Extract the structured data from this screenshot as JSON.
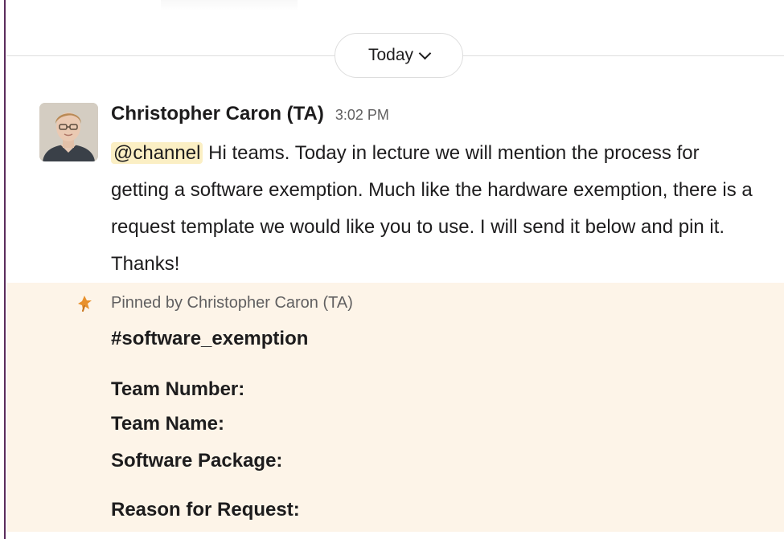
{
  "date_divider": {
    "label": "Today"
  },
  "message": {
    "author": "Christopher Caron (TA)",
    "timestamp": "3:02 PM",
    "mention": "@channel",
    "body": "Hi teams. Today in lecture we will mention the process for getting a software exemption. Much like the hardware exemption, there is a request template we would like you to use. I will send it below and pin it. Thanks!"
  },
  "pinned": {
    "label": "Pinned by Christopher Caron (TA)",
    "lines": [
      "#software_exemption",
      "Team Number:",
      "Team Name:",
      "Software Package:",
      "Reason for Request:"
    ]
  },
  "colors": {
    "sidebar_edge": "#5b2c5c",
    "pinned_background": "#fdf4e8",
    "mention_highlight": "#fbefc4",
    "pin_icon": "#e8912d"
  },
  "icons": {
    "date_chevron": "chevron-down-icon",
    "pin": "pin-icon",
    "avatar": "user-avatar"
  }
}
